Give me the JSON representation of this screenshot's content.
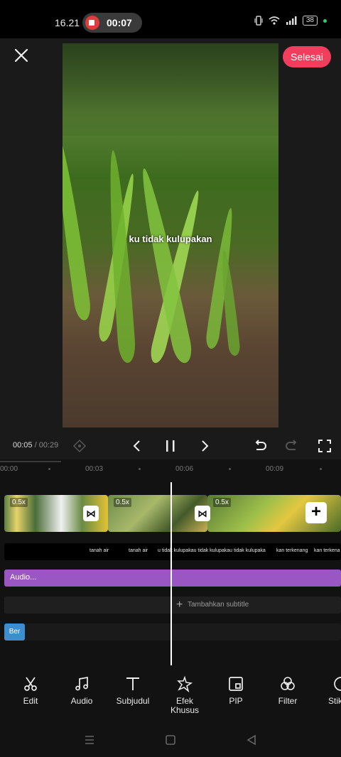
{
  "status_bar": {
    "time": "16.21",
    "recording_time": "00:07",
    "battery": "38"
  },
  "header": {
    "done_label": "Selesai"
  },
  "preview": {
    "caption": "ku tidak kulupakan"
  },
  "playback": {
    "current_time": "00:05",
    "total_time": " / 00:29"
  },
  "timeline": {
    "ruler": [
      "00:00",
      "00:03",
      "00:06",
      "00:09"
    ],
    "clips": [
      {
        "speed": "0.5x"
      },
      {
        "speed": "0.5x"
      },
      {
        "speed": "0.5x"
      }
    ],
    "subtitle_snippets": [
      "tanah air",
      "tanah air",
      "u tidak kulupakau tidak kulupakau tidak kulupaka",
      "kan terkenang",
      "kan terkena"
    ],
    "audio_label": "Audio...",
    "add_subtitle_label": "Tambahkan subtitle",
    "text_chip_label": "Ber"
  },
  "toolbar": {
    "items": [
      {
        "label": "Edit",
        "icon": "scissors-icon"
      },
      {
        "label": "Audio",
        "icon": "music-note-icon"
      },
      {
        "label": "Subjudul",
        "icon": "text-icon"
      },
      {
        "label": "Efek\nKhusus",
        "icon": "sparkle-star-icon"
      },
      {
        "label": "PIP",
        "icon": "pip-icon"
      },
      {
        "label": "Filter",
        "icon": "filter-circles-icon"
      },
      {
        "label": "Stik",
        "icon": "sticker-icon"
      }
    ]
  },
  "colors": {
    "accent": "#f23d5d",
    "audio_track": "#9a56c2",
    "text_chip": "#3d8ed0"
  }
}
